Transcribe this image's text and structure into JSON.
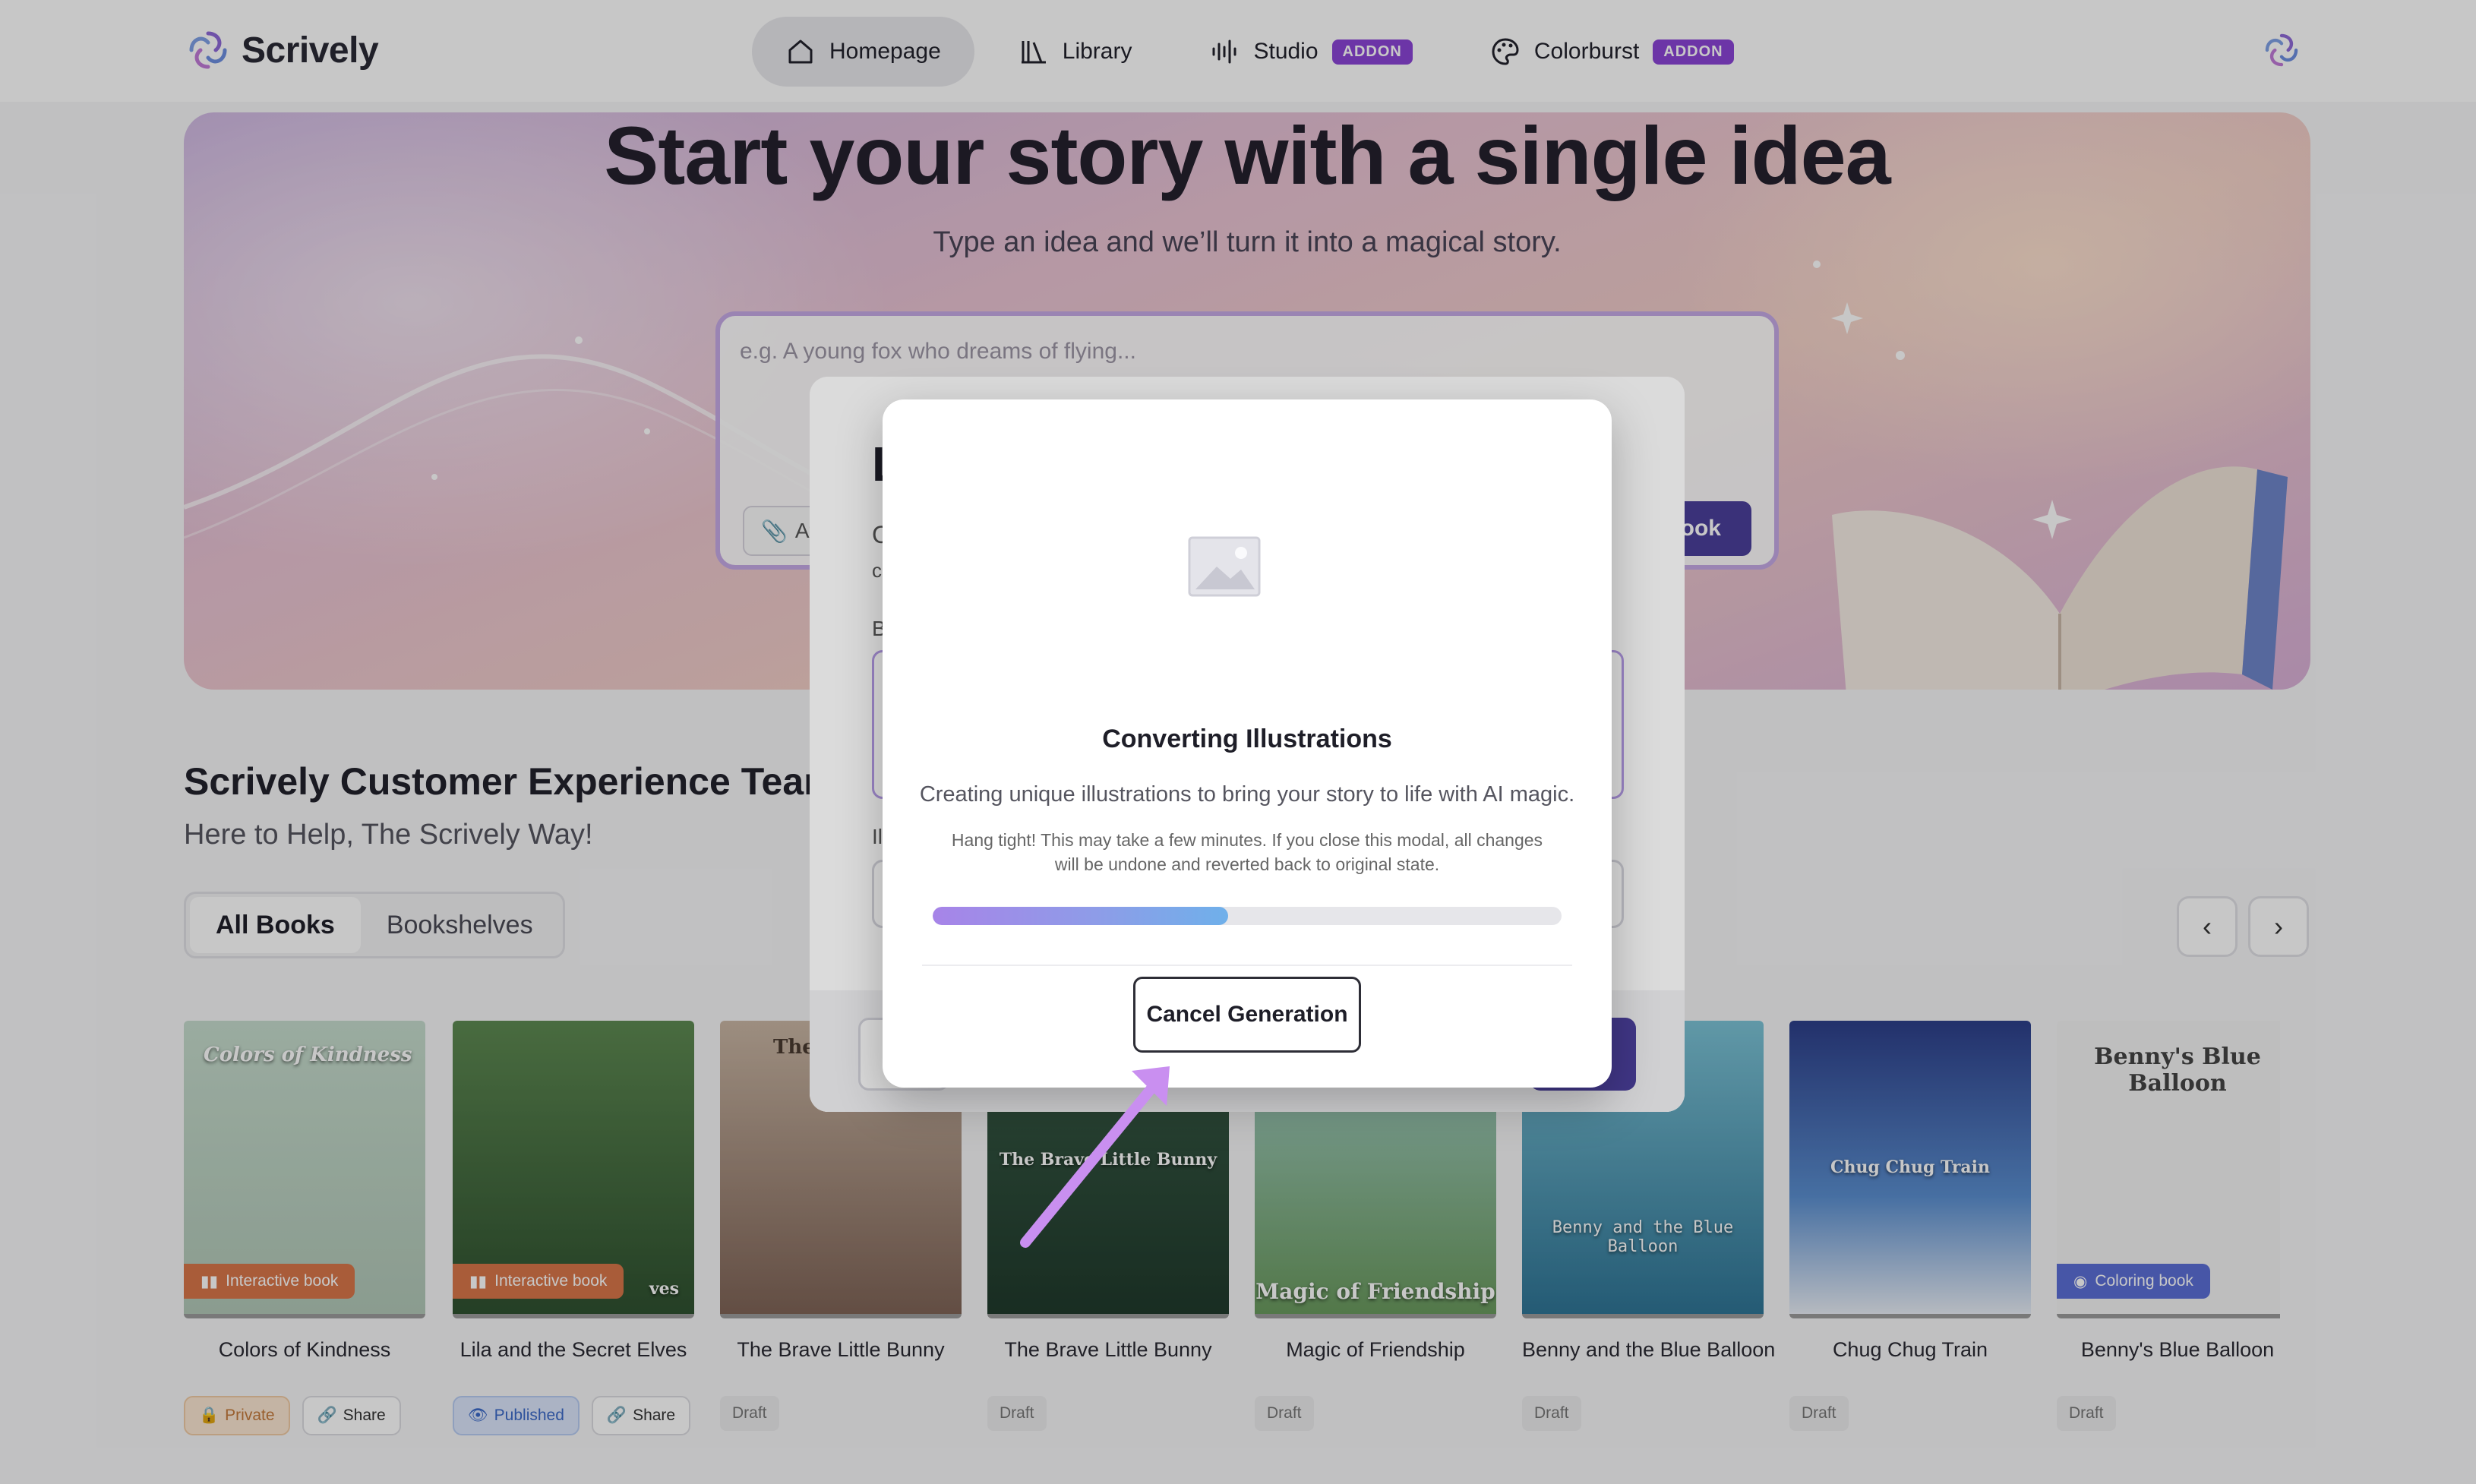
{
  "app": {
    "name": "Scrively"
  },
  "nav": {
    "items": [
      {
        "label": "Homepage",
        "icon": "home-icon",
        "active": true,
        "badge": ""
      },
      {
        "label": "Library",
        "icon": "library-icon",
        "active": false,
        "badge": ""
      },
      {
        "label": "Studio",
        "icon": "waveform-icon",
        "active": false,
        "badge": "ADDON"
      },
      {
        "label": "Colorburst",
        "icon": "palette-icon",
        "active": false,
        "badge": "ADDON"
      }
    ]
  },
  "hero": {
    "title": "Start your story with a single idea",
    "subtitle": "Type an idea and we’ll turn it into a magical story.",
    "input_placeholder": "e.g. A young fox who dreams of flying...",
    "attach_label": "At",
    "create_label": "ook"
  },
  "author": {
    "name": "Scrively Customer Experience Team",
    "tagline": "Here to Help, The Scrively Way!"
  },
  "view_tabs": [
    "All Books",
    "Bookshelves"
  ],
  "books": [
    {
      "title": "Colors of Kindness",
      "cover_text": "Colors of Kindness",
      "tag": "Interactive book",
      "status": "Private",
      "share": "Share",
      "bg": "#bcd3c4"
    },
    {
      "title": "Lila and the Secret Elves",
      "cover_text": "ves",
      "tag": "Interactive book",
      "status": "Published",
      "share": "Share",
      "bg": "#3e6b3d"
    },
    {
      "title": "The Brave Little Bunny",
      "cover_text": "The",
      "tag": "",
      "status": "Draft",
      "share": "",
      "bg": "#8a6e63"
    },
    {
      "title": "The Brave Little Bunny",
      "cover_text": "The Brave Little Bunny",
      "tag": "",
      "status": "Draft",
      "share": "",
      "bg": "#2d4a38"
    },
    {
      "title": "Magic of Friendship",
      "cover_text": "Magic of Friendship",
      "tag": "",
      "status": "Draft",
      "share": "",
      "bg": "#6a9a5e"
    },
    {
      "title": "Benny and the Blue Balloon",
      "cover_text": "Benny and the Blue Balloon",
      "tag": "",
      "status": "Draft",
      "share": "",
      "bg": "#4d93b0"
    },
    {
      "title": "Chug Chug Train",
      "cover_text": "Chug Chug Train",
      "tag": "",
      "status": "Draft",
      "share": "",
      "bg": "#3b5aa8"
    },
    {
      "title": "Benny's Blue Balloon",
      "cover_text": "Benny's Blue Balloon",
      "tag": "Coloring book",
      "status": "Draft",
      "share": "",
      "bg": "#f4f4f4"
    }
  ],
  "modal": {
    "title": "Converting Illustrations",
    "description": "Creating unique illustrations to bring your story to life with AI magic.",
    "note": "Hang tight! This may take a few minutes. If you close this modal, all changes will be undone and reverted back to original state.",
    "progress": 0.47,
    "cancel_label": "Cancel Generation"
  },
  "back_modal": {
    "title_initial": "L",
    "line1_initial": "C",
    "line2_initial": "c",
    "label1_initial": "B",
    "label2_initial": "Il"
  },
  "colors": {
    "accent": "#8b45d6",
    "primary_button": "#4b3f9c",
    "progress_start": "#a784e8",
    "progress_end": "#6fb0ea"
  }
}
